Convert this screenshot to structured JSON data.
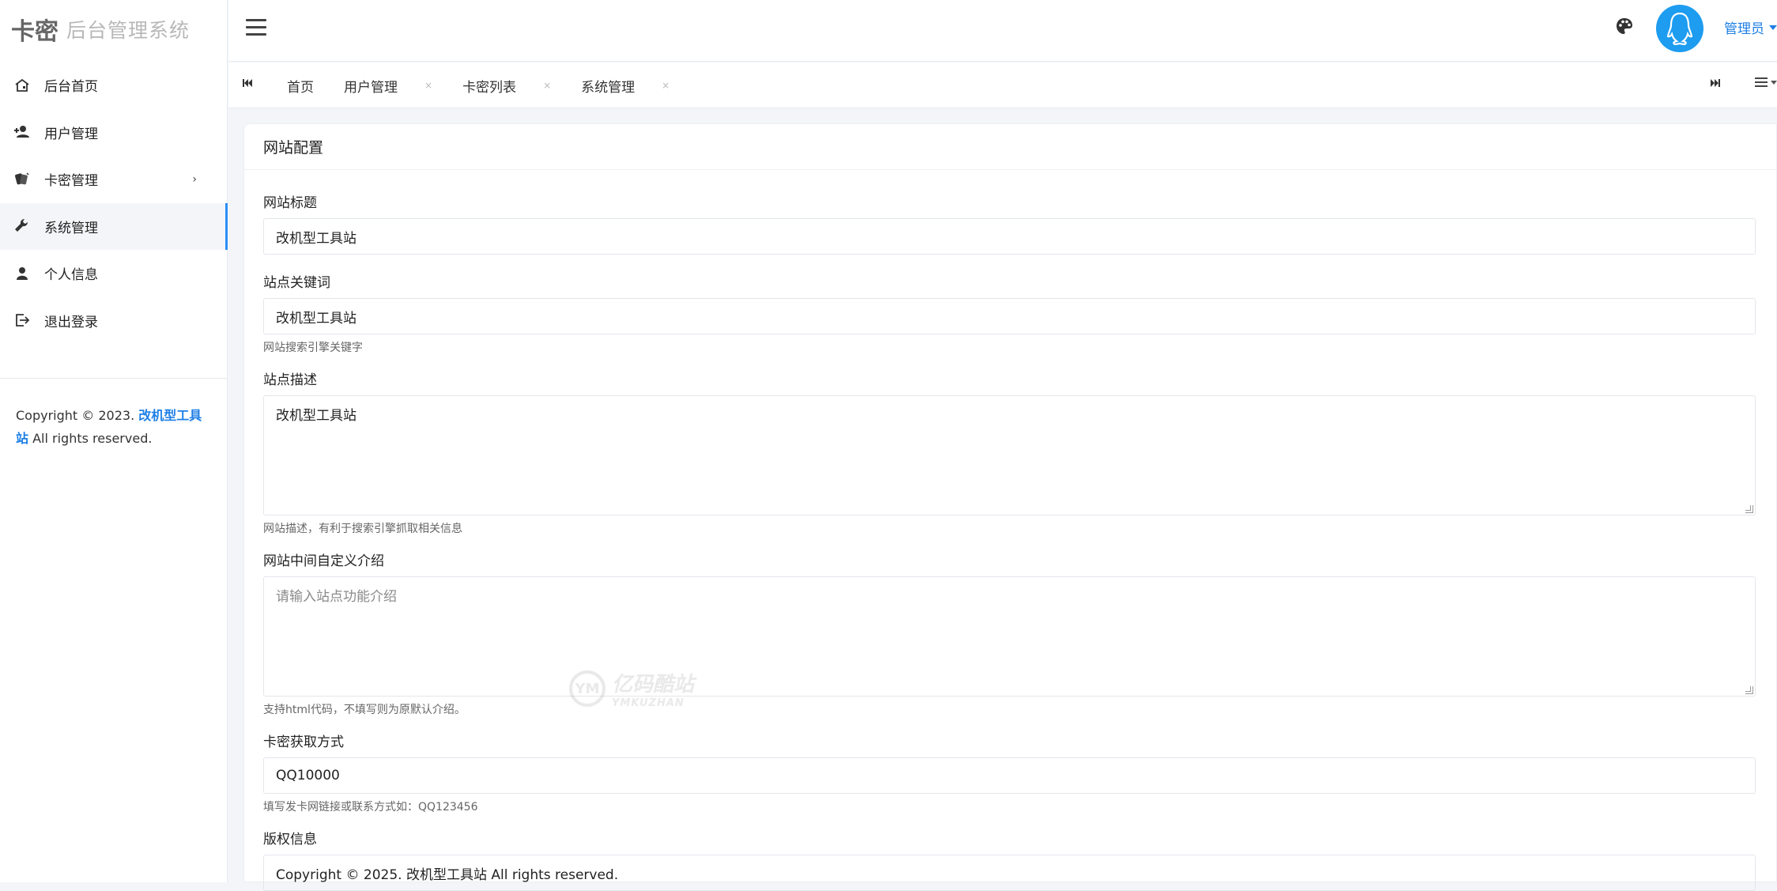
{
  "brand": {
    "primary": "卡密",
    "secondary": "后台管理系统"
  },
  "sidebar": {
    "items": [
      {
        "label": "后台首页",
        "icon": "home-icon"
      },
      {
        "label": "用户管理",
        "icon": "user-add-icon"
      },
      {
        "label": "卡密管理",
        "icon": "cards-icon",
        "arrow": "›"
      },
      {
        "label": "系统管理",
        "icon": "wrench-icon",
        "active": true
      },
      {
        "label": "个人信息",
        "icon": "person-icon"
      },
      {
        "label": "退出登录",
        "icon": "logout-icon"
      }
    ],
    "copyright_prefix": "Copyright © 2023.",
    "copyright_link": "改机型工具站",
    "copyright_suffix": "All rights reserved."
  },
  "header": {
    "user_label": "管理员"
  },
  "tabs": {
    "items": [
      {
        "label": "首页"
      },
      {
        "label": "用户管理"
      },
      {
        "label": "卡密列表"
      },
      {
        "label": "系统管理"
      }
    ],
    "close_glyph": "×"
  },
  "form": {
    "title": "网站配置",
    "site_title": {
      "label": "网站标题",
      "value": "改机型工具站"
    },
    "keywords": {
      "label": "站点关键词",
      "value": "改机型工具站",
      "help": "网站搜索引擎关键字"
    },
    "description": {
      "label": "站点描述",
      "value": "改机型工具站",
      "help": "网站描述，有利于搜索引擎抓取相关信息"
    },
    "intro": {
      "label": "网站中间自定义介绍",
      "placeholder": "请输入站点功能介绍",
      "help": "支持html代码，不填写则为原默认介绍。"
    },
    "card_method": {
      "label": "卡密获取方式",
      "value": "QQ10000",
      "help": "填写发卡网链接或联系方式如：QQ123456"
    },
    "copyright": {
      "label": "版权信息",
      "value": "Copyright © 2025. 改机型工具站 All rights reserved."
    }
  },
  "watermark": {
    "mark": "YM",
    "title": "亿码酷站",
    "subtitle": "YMKUZHAN"
  },
  "colors": {
    "accent": "#1e7fe6",
    "avatar": "#1d9cf0",
    "active_bar": "#2b8ef7"
  }
}
